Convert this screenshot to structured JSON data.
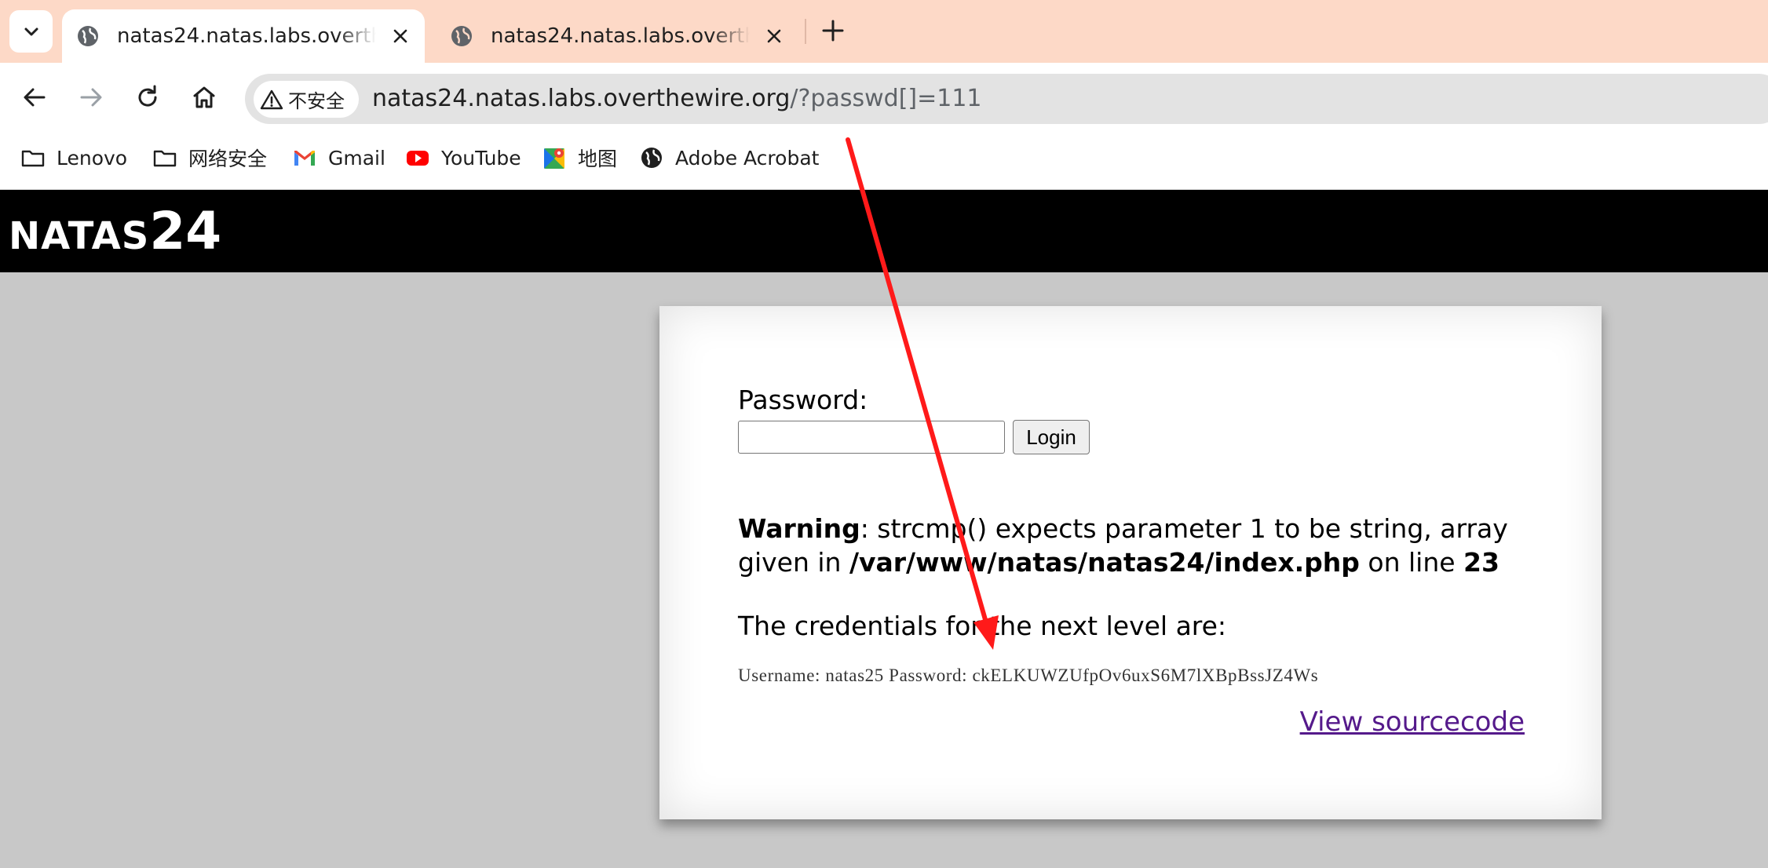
{
  "browser": {
    "tabs": [
      {
        "title": "natas24.natas.labs.overthewire.org",
        "active": true
      },
      {
        "title": "natas24.natas.labs.overthewire.org",
        "active": false
      }
    ],
    "security_chip": "不安全",
    "url_host": "natas24.natas.labs.overthewire.org",
    "url_path": "/?passwd[]=111",
    "bookmarks": [
      {
        "label": "Lenovo",
        "icon": "folder-icon"
      },
      {
        "label": "网络安全",
        "icon": "folder-icon"
      },
      {
        "label": "Gmail",
        "icon": "gmail-icon"
      },
      {
        "label": "YouTube",
        "icon": "youtube-icon"
      },
      {
        "label": "地图",
        "icon": "maps-icon"
      },
      {
        "label": "Adobe Acrobat",
        "icon": "globe-icon"
      }
    ]
  },
  "page": {
    "logo_word": "NATAS",
    "logo_number": "24",
    "password_label": "Password:",
    "login_label": "Login",
    "warning_label": "Warning",
    "warning_text": ": strcmp() expects parameter 1 to be string, array given in ",
    "warning_path": "/var/www/natas/natas24/index.php",
    "warning_online": " on line ",
    "warning_line": "23",
    "credentials_intro": "The credentials for the next level are:",
    "credentials_line": "Username: natas25 Password: ckELKUWZUfpOv6uxS6M7lXBpBssJZ4Ws",
    "source_link": "View sourcecode"
  },
  "colors": {
    "tabstrip": "#fdd9c7",
    "page_bg": "#c8c8c8",
    "header_bg": "#000000",
    "link": "#551a8b",
    "annotation_arrow": "#ff1a1a"
  }
}
